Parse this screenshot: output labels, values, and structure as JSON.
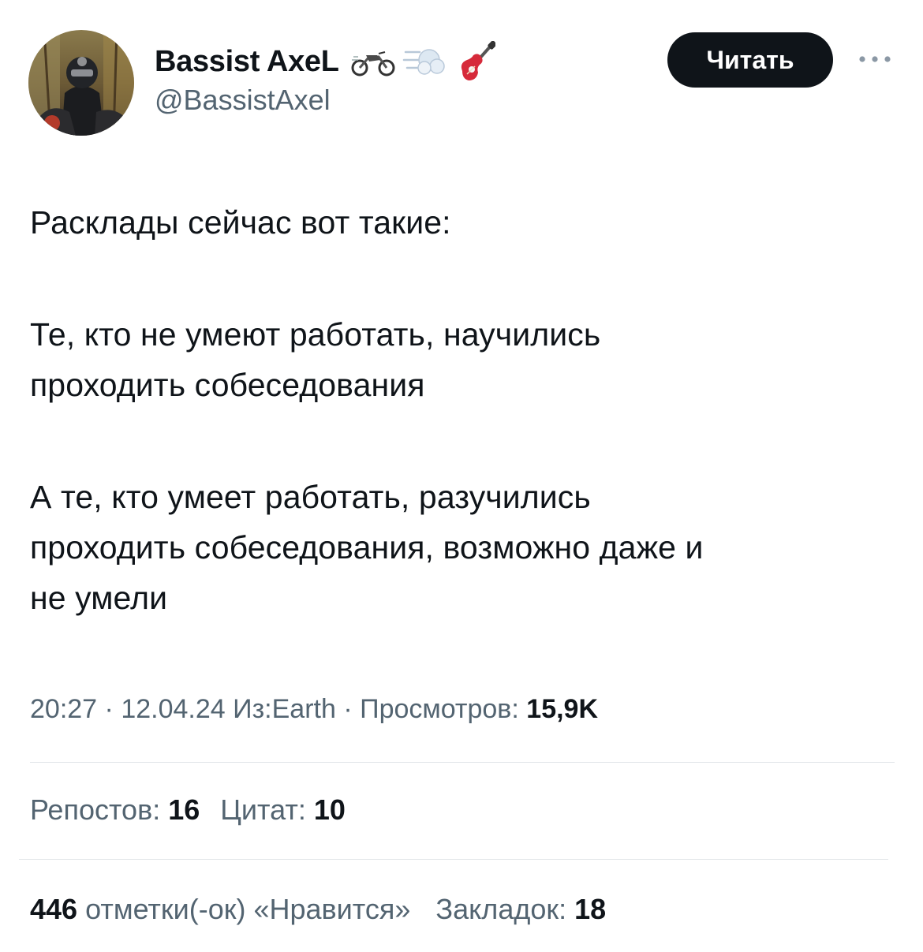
{
  "author": {
    "display_name": "Bassist AxeL",
    "handle": "@BassistAxel",
    "name_emojis": [
      "motorcycle-icon",
      "dash-icon",
      "guitar-icon"
    ]
  },
  "follow_button": {
    "label": "Читать"
  },
  "more_button": {
    "icon": "more-horizontal-icon"
  },
  "tweet": {
    "lines": [
      "Расклады сейчас вот такие:",
      "Те, кто не умеют работать, научились",
      "проходить собеседования",
      "А те, кто умеет работать, разучились",
      "проходить собеседования, возможно даже и",
      "не умели"
    ]
  },
  "meta": {
    "time": "20:27",
    "date": "12.04.24",
    "source": "Из:Earth",
    "views_label": "Просмотров:",
    "views_value": "15,9K"
  },
  "stats": {
    "reposts_label": "Репостов:",
    "reposts_value": "16",
    "quotes_label": "Цитат:",
    "quotes_value": "10",
    "likes_value": "446",
    "likes_label": "отметки(-ок) «Нравится»",
    "bookmarks_label": "Закладок:",
    "bookmarks_value": "18"
  },
  "colors": {
    "text_primary": "#0f1419",
    "text_secondary": "#536471",
    "button_bg": "#0f1419",
    "divider": "#e1e5e8"
  }
}
